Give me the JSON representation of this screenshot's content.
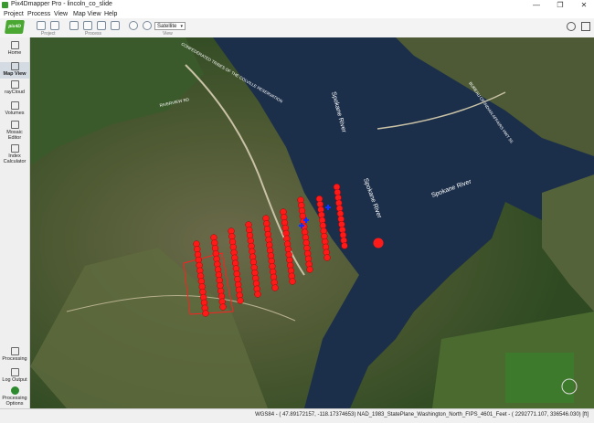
{
  "window": {
    "title": "Pix4Dmapper Pro - lincoln_co_slide",
    "minimize": "—",
    "maximize": "❐",
    "close": "✕"
  },
  "menu": [
    "Project",
    "Process",
    "View",
    "Map View",
    "Help"
  ],
  "toolbar": {
    "logo_text": "pix4D",
    "groups": {
      "project": "Project",
      "process": "Process",
      "view": "View"
    },
    "basemap_value": "Satellite",
    "basemap_arrow": "▾"
  },
  "sidebar": {
    "top": [
      {
        "label": "Home",
        "icon": "home-icon"
      },
      {
        "label": "Map View",
        "icon": "map-view-icon",
        "active": true
      },
      {
        "label": "rayCloud",
        "icon": "raycloud-icon"
      },
      {
        "label": "Volumes",
        "icon": "volumes-icon"
      },
      {
        "label": "Mosaic Editor",
        "icon": "mosaic-editor-icon"
      },
      {
        "label": "Index Calculator",
        "icon": "index-calculator-icon"
      }
    ],
    "bottom": [
      {
        "label": "Processing",
        "icon": "processing-icon"
      },
      {
        "label": "Log Output",
        "icon": "log-output-icon"
      },
      {
        "label": "Processing Options",
        "icon": "processing-options-icon"
      }
    ]
  },
  "map": {
    "river_labels": [
      "Spokane River",
      "Spokane River",
      "Spokane River"
    ],
    "road_labels": [
      "CONFEDERATED TRIBES OF THE COLVILLE RESERVATION",
      "RIVERVIEW RD",
      "BUREAU OF INDIAN AFFAIRS HWY 55"
    ],
    "camera_marker_color": "#ff1a1a",
    "gcp_marker_color": "#1030ff",
    "boundary_color": "#ff2020",
    "water_color": "#1c2f4a"
  },
  "status": {
    "text": "WGS84 - ( 47.89172157, -118.17374653)  NAD_1983_StatePlane_Washington_North_FIPS_4601_Feet - ( 2292771.107,  336546.030) [ft]"
  }
}
